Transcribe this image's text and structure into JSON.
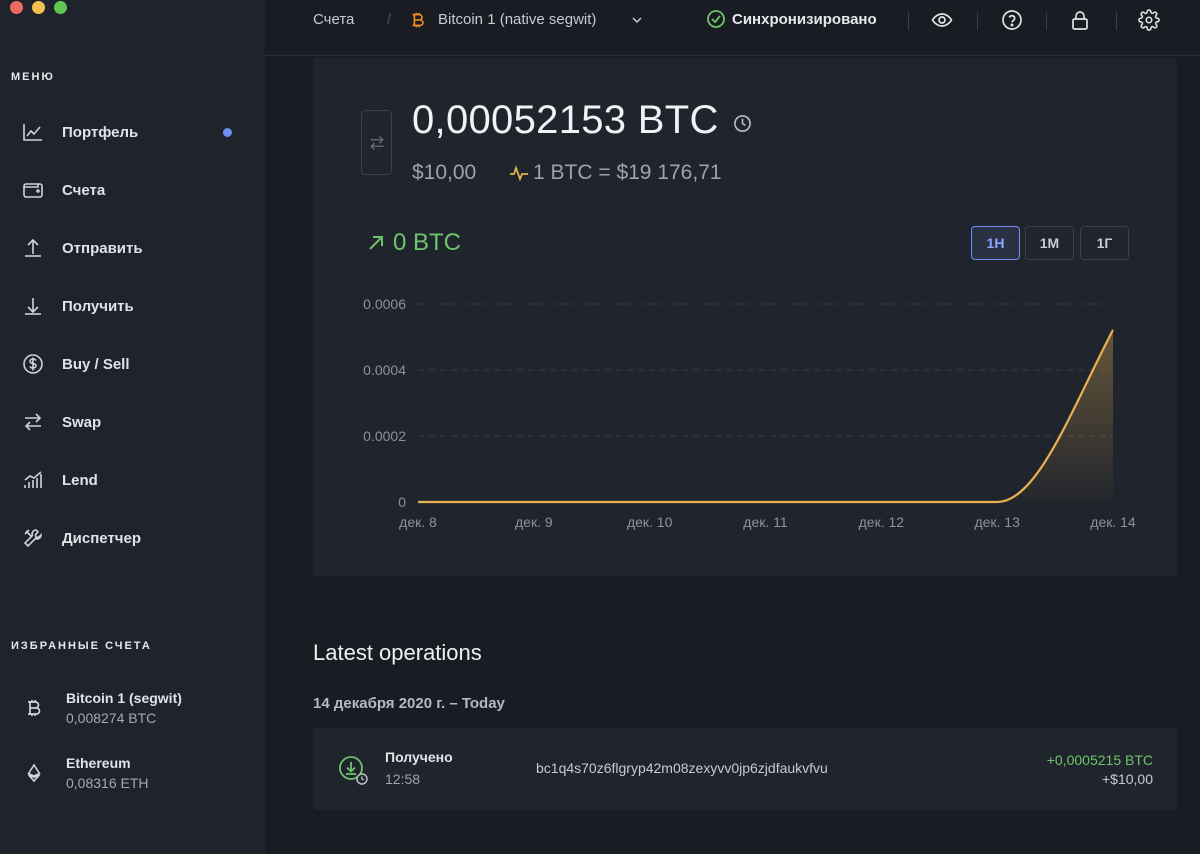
{
  "window": {
    "traffic_lights": [
      "#ed6a5e",
      "#f5bf4f",
      "#61c554"
    ]
  },
  "sidebar": {
    "menu_label": "МЕНЮ",
    "items": [
      {
        "label": "Портфель",
        "icon": "chart-icon",
        "active_dot": true
      },
      {
        "label": "Счета",
        "icon": "wallet-icon"
      },
      {
        "label": "Отправить",
        "icon": "send-icon"
      },
      {
        "label": "Получить",
        "icon": "receive-icon"
      },
      {
        "label": "Buy / Sell",
        "icon": "dollar-icon"
      },
      {
        "label": "Swap",
        "icon": "swap-icon"
      },
      {
        "label": "Lend",
        "icon": "lend-icon"
      },
      {
        "label": "Диспетчер",
        "icon": "tools-icon"
      }
    ],
    "favorites_label": "ИЗБРАННЫЕ СЧЕТА",
    "favorites": [
      {
        "name": "Bitcoin 1 (segwit)",
        "balance": "0,008274 BTC",
        "icon": "bitcoin-icon"
      },
      {
        "name": "Ethereum",
        "balance": "0,08316 ETH",
        "icon": "ethereum-icon"
      }
    ]
  },
  "topbar": {
    "breadcrumb_root": "Счета",
    "separator": "/",
    "account_name": "Bitcoin 1 (native segwit)",
    "sync_status": "Синхронизировано",
    "colors": {
      "bitcoin": "#f7931a",
      "sync": "#6fc46b"
    }
  },
  "account": {
    "balance": "0,00052153 BTC",
    "fiat": "$10,00",
    "rate": "1 BTC = $19 176,71",
    "delta": "0 BTC",
    "ranges": [
      "1Н",
      "1М",
      "1Г"
    ],
    "active_range": "1Н"
  },
  "chart_data": {
    "type": "area",
    "x": [
      "дек. 8",
      "дек. 9",
      "дек. 10",
      "дек. 11",
      "дек. 12",
      "дек. 13",
      "дек. 14"
    ],
    "series": [
      {
        "values": [
          0,
          0,
          0,
          0,
          0,
          0,
          0.00052153
        ],
        "color": "#e6b252"
      }
    ],
    "yticks": [
      "0.0006",
      "0.0004",
      "0.0002",
      "0"
    ],
    "ylim": [
      0,
      0.0006
    ],
    "grid": true,
    "xlabel": "",
    "ylabel": ""
  },
  "operations": {
    "title": "Latest operations",
    "date_header": "14 декабря 2020 г. – Today",
    "items": [
      {
        "type": "Получено",
        "time": "12:58",
        "address": "bc1q4s70z6flgryp42m08zexyvv0jp6zjdfaukvfvu",
        "amount": "+0,0005215 BTC",
        "fiat": "+$10,00"
      }
    ]
  },
  "accent": "#6c8ef5"
}
